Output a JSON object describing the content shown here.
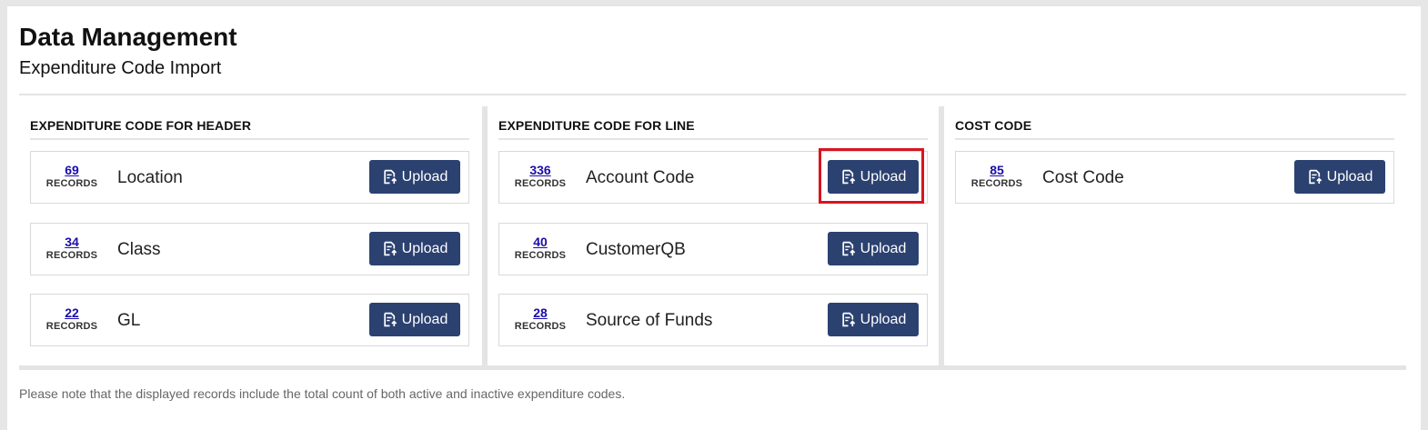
{
  "header": {
    "title": "Data Management",
    "subtitle": "Expenditure Code Import"
  },
  "records_label": "RECORDS",
  "upload_label": "Upload",
  "upload_icon": "file-upload-icon",
  "colors": {
    "button_bg": "#2b4170",
    "link": "#1a0dab",
    "highlight": "#d9141e"
  },
  "sections": [
    {
      "heading": "EXPENDITURE CODE FOR HEADER",
      "rows": [
        {
          "count": "69",
          "label": "Location"
        },
        {
          "count": "34",
          "label": "Class"
        },
        {
          "count": "22",
          "label": "GL"
        }
      ]
    },
    {
      "heading": "EXPENDITURE CODE FOR LINE",
      "rows": [
        {
          "count": "336",
          "label": "Account Code",
          "highlighted": true
        },
        {
          "count": "40",
          "label": "CustomerQB"
        },
        {
          "count": "28",
          "label": "Source of Funds"
        }
      ]
    },
    {
      "heading": "COST CODE",
      "rows": [
        {
          "count": "85",
          "label": "Cost Code"
        }
      ]
    }
  ],
  "footnote": "Please note that the displayed records include the total count of both active and inactive expenditure codes."
}
